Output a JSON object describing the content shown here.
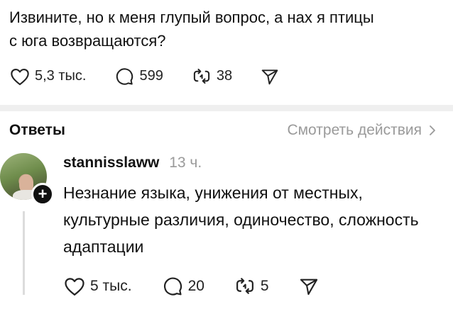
{
  "post": {
    "text": "Извините, но к меня глупый вопрос, а нах  я птицы\nс юга возвращаются?",
    "likes": "5,3 тыс.",
    "comments": "599",
    "reposts": "38"
  },
  "replies_section": {
    "title": "Ответы",
    "activity_link": "Смотреть действия"
  },
  "reply": {
    "username": "stannisslaww",
    "time": "13 ч.",
    "text": "Незнание языка, унижения от местных, культурные различия, одиночество, сложность адаптации",
    "likes": "5 тыс.",
    "comments": "20",
    "reposts": "5"
  },
  "icons": {
    "like": "heart-icon",
    "comment": "comment-bubble-icon",
    "repost": "repost-icon",
    "share": "send-icon",
    "chevron": "chevron-right-icon",
    "follow": "plus-icon"
  },
  "colors": {
    "text": "#111111",
    "muted": "#9a9a9a",
    "divider": "#efefef"
  }
}
